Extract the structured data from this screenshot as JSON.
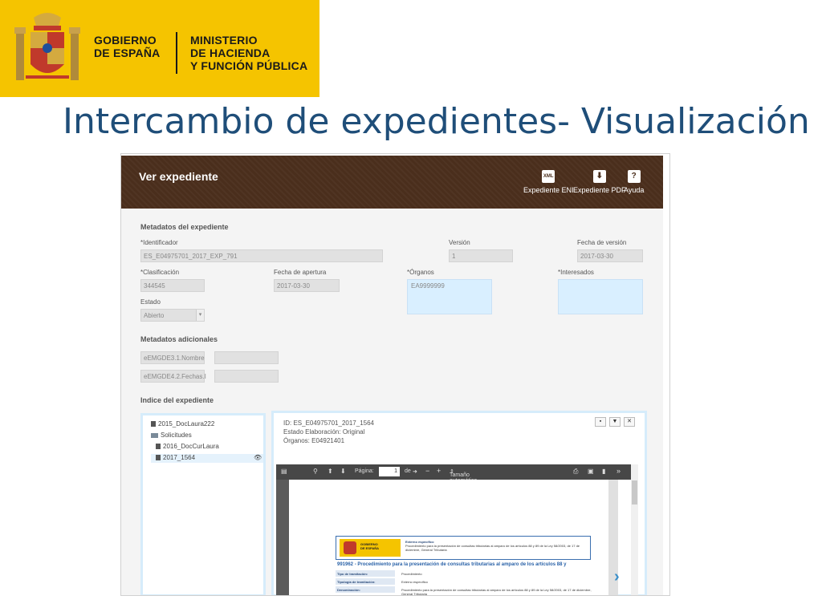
{
  "header": {
    "gov_line1": "GOBIERNO",
    "gov_line2": "DE ESPAÑA",
    "min_line1": "MINISTERIO",
    "min_line2": "DE HACIENDA",
    "min_line3": "Y FUNCIÓN PÚBLICA"
  },
  "slide_title": "Intercambio de expedientes- Visualización",
  "app": {
    "title": "Ver expediente",
    "toolbar": [
      {
        "label": "Expediente ENI",
        "icon": "xml-file-icon",
        "glyph": "XML"
      },
      {
        "label": "Expediente PDF",
        "icon": "download-icon",
        "glyph": "⬇"
      },
      {
        "label": "Ayuda",
        "icon": "help-icon",
        "glyph": "?"
      }
    ],
    "metadata": {
      "heading": "Metadatos del expediente",
      "identificador_label": "*Identificador",
      "identificador_value": "ES_E04975701_2017_EXP_791",
      "version_label": "Versión",
      "version_value": "1",
      "fecha_version_label": "Fecha de versión",
      "fecha_version_value": "2017-03-30",
      "clasificacion_label": "*Clasificación",
      "clasificacion_value": "344545",
      "fecha_apertura_label": "Fecha de apertura",
      "fecha_apertura_value": "2017-03-30",
      "organos_label": "*Órganos",
      "organos_value": "EA9999999",
      "interesados_label": "*Interesados",
      "interesados_value": "",
      "estado_label": "Estado",
      "estado_value": "Abierto"
    },
    "additional": {
      "heading": "Metadatos adicionales",
      "rows": [
        {
          "key": "eEMGDE3.1.Nombre",
          "value": ""
        },
        {
          "key": "eEMGDE4.2.Fechas.I",
          "value": ""
        }
      ]
    },
    "index": {
      "heading": "Indice del expediente",
      "items": [
        {
          "label": "2015_DocLaura222",
          "icon": "document-icon"
        },
        {
          "label": "Solicitudes",
          "icon": "folder-icon"
        },
        {
          "label": "2016_DocCurLaura",
          "icon": "document-icon"
        },
        {
          "label": "2017_1564",
          "icon": "document-icon"
        }
      ]
    },
    "viewer": {
      "id_line": "ID: ES_E04975701_2017_1564",
      "estado_line": "Estado Elaboración: Original",
      "organos_line": "Órganos: E04921401",
      "pdf": {
        "page_label": "Página:",
        "page_value": "1",
        "of_label": "de",
        "zoom_label": "Tamaño automático",
        "doc_title": "991962 - Procedimiento para la presentación de consultas tributarias al amparo de los artículos 88 y",
        "rows": [
          {
            "k": "Tipo de tramitación:",
            "v": "Procedimiento"
          },
          {
            "k": "Tipología de tramitación:",
            "v": "Externo específico"
          },
          {
            "k": "Denominación:",
            "v": "Procedimiento para la presentación de consultas tributarias al amparo de los artículos 88 y 89 de la Ley 58/2003, de 17 de diciembre, General Tributaria"
          }
        ]
      }
    }
  }
}
